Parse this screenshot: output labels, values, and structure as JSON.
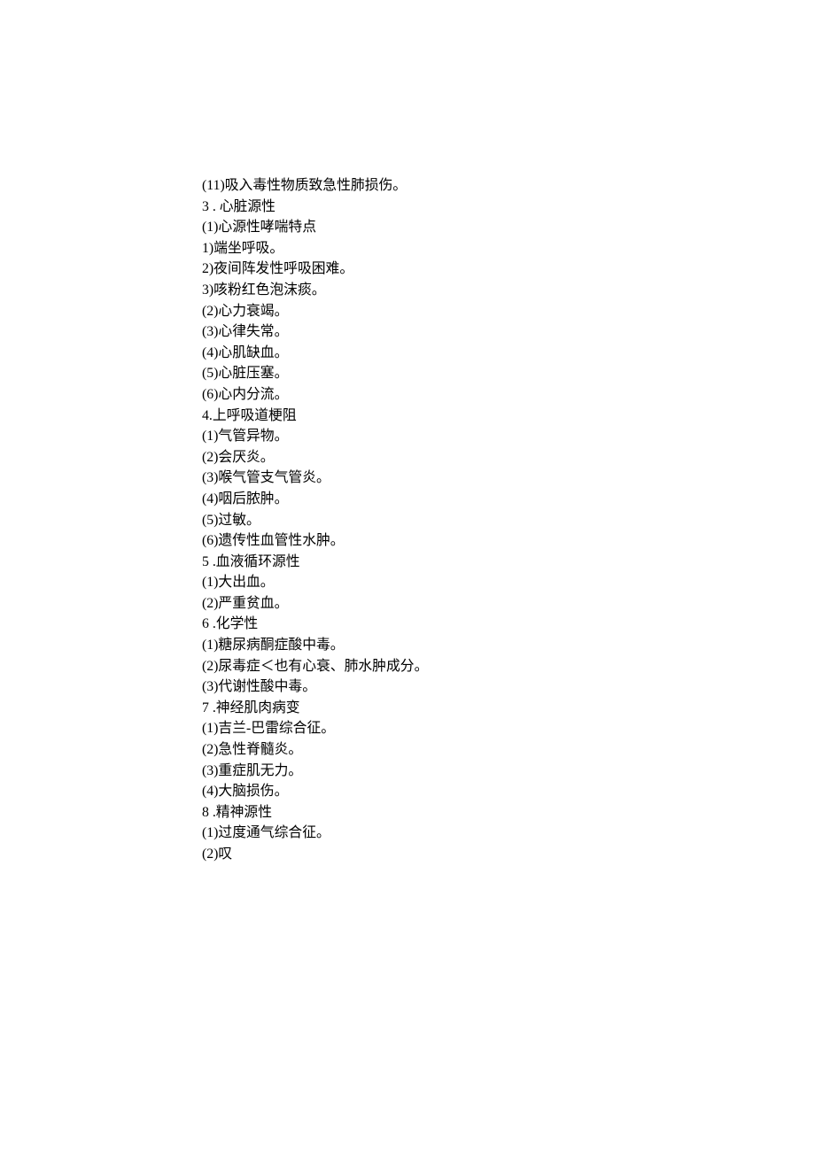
{
  "lines": [
    "(11)吸入毒性物质致急性肺损伤。",
    "3 . 心脏源性",
    "(1)心源性哮喘特点",
    "1)端坐呼吸。",
    "2)夜间阵发性呼吸困难。",
    "3)咳粉红色泡沫痰。",
    "(2)心力衰竭。",
    "(3)心律失常。",
    "(4)心肌缺血。",
    "(5)心脏压塞。",
    "(6)心内分流。",
    "4.上呼吸道梗阻",
    "(1)气管异物。",
    "(2)会厌炎。",
    "(3)喉气管支气管炎。",
    "(4)咽后脓肿。",
    "(5)过敏。",
    "(6)遗传性血管性水肿。",
    "5 .血液循环源性",
    "(1)大出血。",
    "(2)严重贫血。",
    "6 .化学性",
    "(1)糖尿病酮症酸中毒。",
    "(2)尿毒症＜也有心衰、肺水肿成分。",
    "(3)代谢性酸中毒。",
    "7 .神经肌肉病变",
    "(1)吉兰-巴雷综合征。",
    "(2)急性脊髓炎。",
    "(3)重症肌无力。",
    "(4)大脑损伤。",
    "8 .精神源性",
    "(1)过度通气综合征。",
    "(2)叹"
  ]
}
